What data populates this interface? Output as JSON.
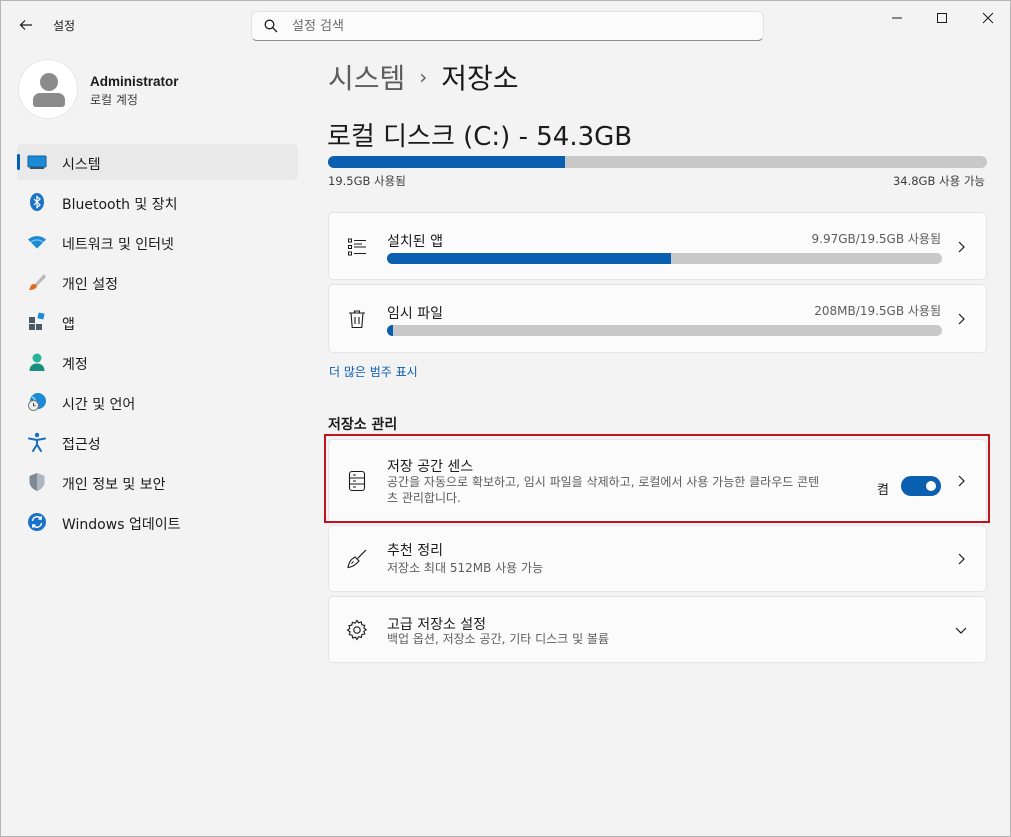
{
  "titlebar": {
    "app_title": "설정",
    "search_placeholder": "설정 검색"
  },
  "profile": {
    "name": "Administrator",
    "account_type": "로컬 계정"
  },
  "sidebar": {
    "items": [
      {
        "label": "시스템",
        "icon": "system-icon",
        "active": true
      },
      {
        "label": "Bluetooth 및 장치",
        "icon": "bluetooth-icon"
      },
      {
        "label": "네트워크 및 인터넷",
        "icon": "wifi-icon"
      },
      {
        "label": "개인 설정",
        "icon": "brush-icon"
      },
      {
        "label": "앱",
        "icon": "apps-icon"
      },
      {
        "label": "계정",
        "icon": "account-icon"
      },
      {
        "label": "시간 및 언어",
        "icon": "globe-clock-icon"
      },
      {
        "label": "접근성",
        "icon": "accessibility-icon"
      },
      {
        "label": "개인 정보 및 보안",
        "icon": "shield-icon"
      },
      {
        "label": "Windows 업데이트",
        "icon": "update-icon"
      }
    ]
  },
  "main": {
    "breadcrumb_parent": "시스템",
    "breadcrumb_sep": "›",
    "breadcrumb_current": "저장소",
    "disk": {
      "title": "로컬 디스크 (C:) - 54.3GB",
      "used_label": "19.5GB 사용됨",
      "free_label": "34.8GB 사용 가능",
      "used_fraction": 0.359
    },
    "categories": [
      {
        "title": "설치된 앱",
        "usage": "9.97GB/19.5GB 사용됨",
        "fraction": 0.511,
        "icon": "list-icon"
      },
      {
        "title": "임시 파일",
        "usage": "208MB/19.5GB 사용됨",
        "fraction": 0.011,
        "icon": "trash-icon"
      }
    ],
    "more_link": "더 많은 범주 표시",
    "section_title": "저장소 관리",
    "storage_sense": {
      "title": "저장 공간 센스",
      "desc_line1": "공간을 자동으로 확보하고, 임시 파일을 삭제하고, 로컬에서 사용 가능한 클라우드 콘텐",
      "desc_line2": "츠 관리합니다.",
      "toggle_label": "켬",
      "toggle_on": true
    },
    "cleanup": {
      "title": "추천 정리",
      "desc": "저장소 최대 512MB 사용 가능"
    },
    "advanced": {
      "title": "고급 저장소 설정",
      "desc": "백업 옵션, 저장소 공간, 기타 디스크 및 볼륨"
    }
  },
  "colors": {
    "accent": "#0a5fb0",
    "highlight": "#c0141c"
  }
}
